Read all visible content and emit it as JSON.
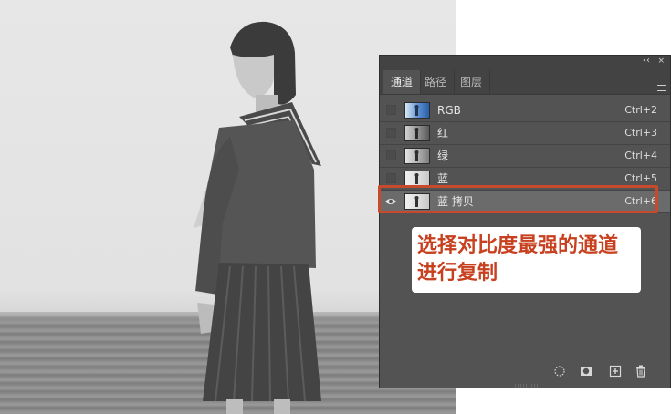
{
  "panel": {
    "tabs": [
      {
        "label": "通道",
        "active": true
      },
      {
        "label": "路径",
        "active": false
      },
      {
        "label": "图层",
        "active": false
      }
    ],
    "channels": [
      {
        "label": "RGB",
        "shortcut": "Ctrl+2",
        "visible": false,
        "thumb": "color"
      },
      {
        "label": "红",
        "shortcut": "Ctrl+3",
        "visible": false,
        "thumb": "gray-dark"
      },
      {
        "label": "绿",
        "shortcut": "Ctrl+4",
        "visible": false,
        "thumb": "gray"
      },
      {
        "label": "蓝",
        "shortcut": "Ctrl+5",
        "visible": false,
        "thumb": "gray-light"
      },
      {
        "label": "蓝 拷贝",
        "shortcut": "Ctrl+6",
        "visible": true,
        "selected": true,
        "thumb": "gray-light"
      }
    ],
    "footer_icons": [
      "selection-icon",
      "mask-icon",
      "new-channel-icon",
      "trash-icon"
    ]
  },
  "callout": {
    "line1": "选择对比度最强的通道",
    "line2": "进行复制"
  },
  "colors": {
    "panel_bg": "#535353",
    "highlight": "#c74a2c",
    "callout_text": "#c7401f"
  }
}
